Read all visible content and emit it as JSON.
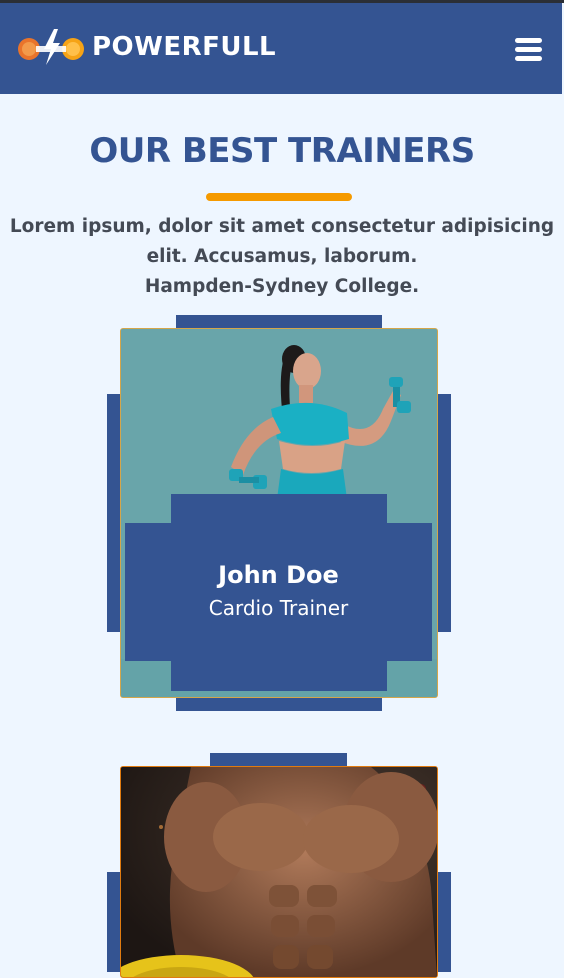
{
  "navbar": {
    "brand": "POWERFULL",
    "logo_icon": "dumbbell-lightning-icon",
    "menu_icon": "hamburger-menu-icon"
  },
  "section": {
    "title": "OUR BEST TRAINERS",
    "description_lines": [
      "Lorem ipsum, dolor sit amet consectetur adipisicing",
      "elit. Accusamus, laborum.",
      "Hampden-Sydney College."
    ]
  },
  "trainers": [
    {
      "name": "John Doe",
      "role": "Cardio Trainer",
      "image": "woman-with-dumbbells"
    },
    {
      "name": "",
      "role": "",
      "image": "muscular-man-with-weight-plate"
    }
  ],
  "colors": {
    "primary": "#345492",
    "accent": "#f59a00",
    "background": "#eef6ff"
  }
}
